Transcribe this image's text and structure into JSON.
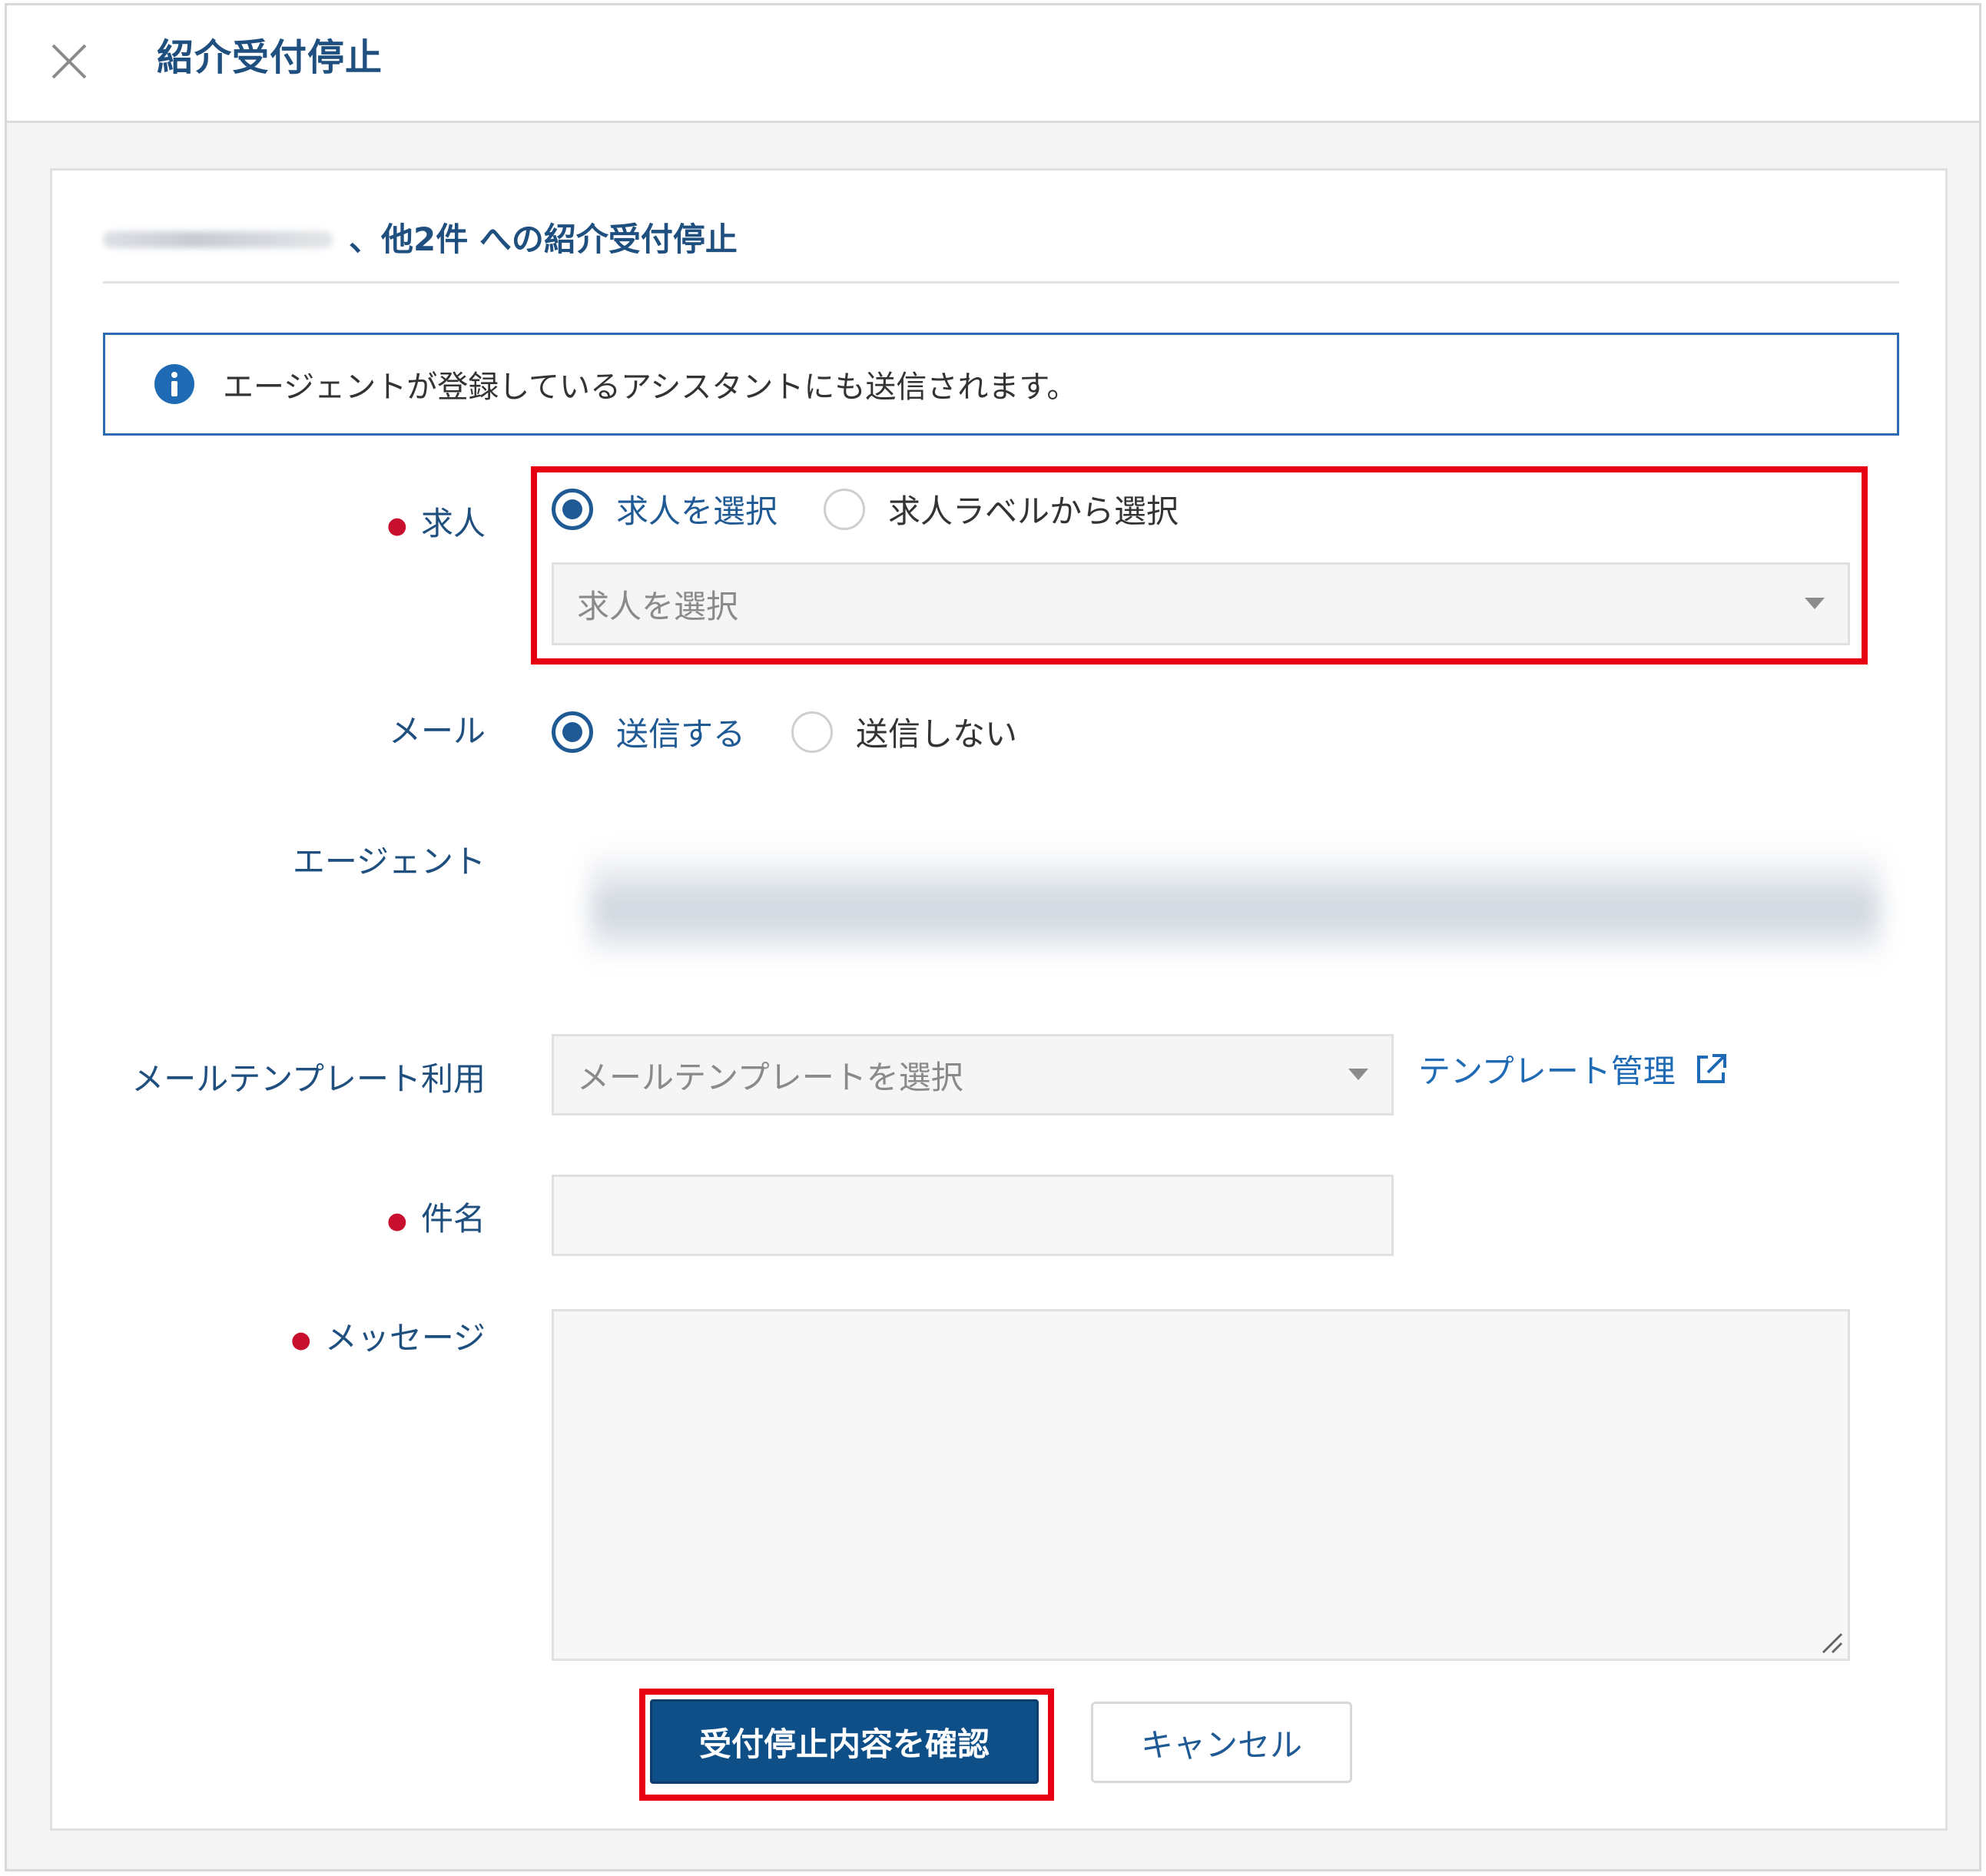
{
  "header": {
    "title": "紹介受付停止"
  },
  "panel": {
    "subtitle": "、他2件 への紹介受付停止",
    "info": "エージェントが登録しているアシスタントにも送信されます。"
  },
  "form": {
    "job": {
      "label": "求人",
      "options": [
        "求人を選択",
        "求人ラベルから選択"
      ],
      "selected": "求人を選択",
      "select_placeholder": "求人を選択"
    },
    "mail": {
      "label": "メール",
      "options": [
        "送信する",
        "送信しない"
      ],
      "selected": "送信する"
    },
    "agent": {
      "label": "エージェント"
    },
    "template": {
      "label": "メールテンプレート利用",
      "placeholder": "メールテンプレートを選択",
      "manage_link": "テンプレート管理"
    },
    "subject": {
      "label": "件名",
      "value": ""
    },
    "message": {
      "label": "メッセージ",
      "value": ""
    }
  },
  "actions": {
    "confirm": "受付停止内容を確認",
    "cancel": "キャンセル"
  },
  "colors": {
    "primary": "#0f4f88",
    "link": "#1f6ab5",
    "highlight": "#e60012",
    "required": "#c8102e"
  },
  "icons": [
    "close-icon",
    "info-icon",
    "external-link-icon",
    "chevron-down-icon"
  ]
}
